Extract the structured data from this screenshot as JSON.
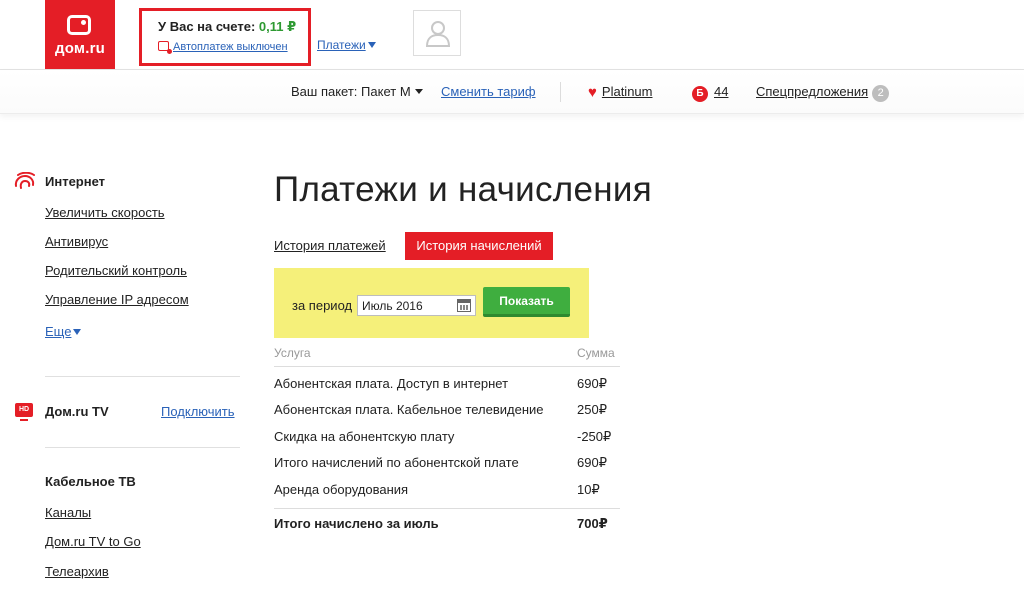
{
  "header": {
    "logo_text": "дом.ru",
    "balance_label": "У Вас на счете:",
    "balance_amount": "0,11 ₽",
    "autopay_text": "Автоплатеж выключен",
    "payments_link": "Платежи"
  },
  "subbar": {
    "package_label": "Ваш пакет:",
    "package_value": "Пакет M",
    "change_tariff": "Сменить тариф",
    "platinum": "Platinum",
    "bonus_badge": "Б",
    "bonus_count": "44",
    "special_offers": "Спецпредложения",
    "special_count": "2"
  },
  "sidebar": {
    "internet": {
      "title": "Интернет",
      "links": [
        "Увеличить скорость",
        "Антивирус",
        "Родительский контроль",
        "Управление IP адресом"
      ],
      "more": "Еще"
    },
    "tv": {
      "icon_text": "HD",
      "title": "Дом.ru TV",
      "connect": "Подключить"
    },
    "cable": {
      "title": "Кабельное ТВ",
      "links": [
        "Каналы",
        "Дом.ru TV to Go",
        "Телеархив"
      ]
    }
  },
  "main": {
    "title": "Платежи и начисления",
    "tabs": [
      "История платежей",
      "История начислений"
    ],
    "period_label": "за период",
    "period_value": "Июль 2016",
    "show_button": "Показать",
    "table": {
      "headers": [
        "Услуга",
        "Сумма"
      ],
      "rows": [
        [
          "Абонентская плата. Доступ в интернет",
          "690₽"
        ],
        [
          "Абонентская плата. Кабельное телевидение",
          "250₽"
        ],
        [
          "Скидка на абонентскую плату",
          "-250₽"
        ],
        [
          "Итого начислений по абонентской плате",
          "690₽"
        ],
        [
          "Аренда оборудования",
          "10₽"
        ]
      ],
      "total": [
        "Итого начислено за июль",
        "700₽"
      ]
    }
  },
  "colors": {
    "brand_red": "#e41e26",
    "link_blue": "#2a62b8",
    "balance_green": "#2e9a32",
    "highlight_yellow": "#f5f07a",
    "button_green": "#3fae3f"
  }
}
